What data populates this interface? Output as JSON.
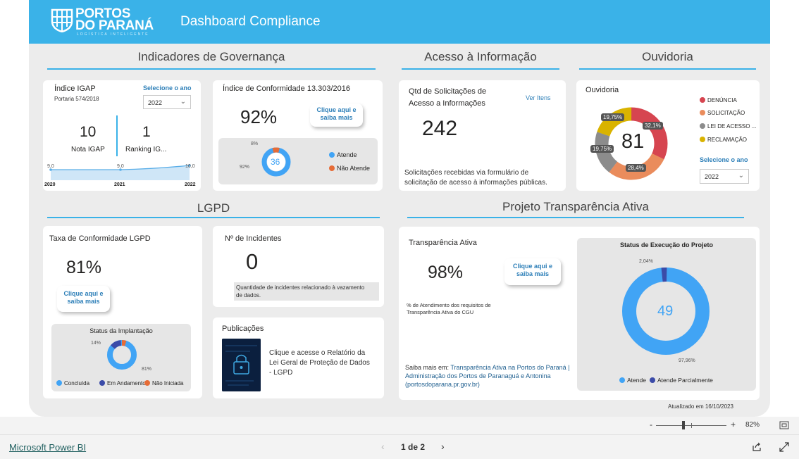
{
  "banner": {
    "logo_line1": "PORTOS",
    "logo_line2": "DO PARANÁ",
    "logo_tagline": "LOGÍSTICA INTELIGENTE",
    "title": "Dashboard Compliance"
  },
  "sections": {
    "governanca": "Indicadores de Governança",
    "acesso": "Acesso à Informação",
    "ouvidoria": "Ouvidoria",
    "lgpd": "LGPD",
    "transparencia": "Projeto Transparência Ativa"
  },
  "igap": {
    "title": "Índice IGAP",
    "subtitle": "Portaria 574/2018",
    "select_label": "Selecione o ano",
    "select_value": "2022",
    "nota_value": "10",
    "nota_label": "Nota IGAP",
    "ranking_value": "1",
    "ranking_label": "Ranking IG...",
    "trend_labels": [
      "9,0",
      "9,0",
      "10,0"
    ],
    "trend_years": [
      "2020",
      "2021",
      "2022"
    ]
  },
  "conformidade": {
    "title": "Índice de Conformidade 13.303/2016",
    "value": "92%",
    "cta": [
      "Clique aqui e",
      "saiba mais"
    ],
    "donut_center": "36",
    "label_small": "8%",
    "label_big": "92%",
    "legend": [
      "Atende",
      "Não Atende"
    ]
  },
  "acesso": {
    "title_line1": "Qtd de Solicitações de",
    "title_line2": "Acesso a Informações",
    "link": "Ver Itens",
    "value": "242",
    "note_line1": "Solicitações recebidas via formulário de",
    "note_line2": "solicitação de acesso à informações públicas."
  },
  "ouvidoria": {
    "title": "Ouvidoria",
    "center": "81",
    "labels": [
      "32,1%",
      "28,4%",
      "19,75%",
      "19,75%"
    ],
    "legend": [
      "DENÚNCIA",
      "SOLICITAÇÃO",
      "LEI DE ACESSO ...",
      "RECLAMAÇÃO"
    ],
    "select_label": "Selecione o ano",
    "select_value": "2022"
  },
  "lgpd": {
    "taxa_title": "Taxa de Conformidade LGPD",
    "taxa_value": "81%",
    "cta": [
      "Clique aqui e",
      "saiba mais"
    ],
    "status_title": "Status da Implantação",
    "status_labels": [
      "14%",
      "81%"
    ],
    "status_legend": [
      "Concluída",
      "Em Andamento",
      "Não Iniciada"
    ],
    "incidentes_title": "Nº de Incidentes",
    "incidentes_value": "0",
    "incidentes_note_line1": "Quantidade de incidentes relacionado à vazamento",
    "incidentes_note_line2": "de dados.",
    "publicacoes_title": "Publicações",
    "publicacoes_text": [
      "Clique e acesse o Relatório da",
      "Lei Geral de Proteção de Dados",
      "- LGPD"
    ]
  },
  "transparencia": {
    "title": "Transparência Ativa",
    "value": "98%",
    "cta": [
      "Clique aqui e",
      "saiba mais"
    ],
    "note_line1": "% de Atendimento dos requisitos de",
    "note_line2": "Transparência Ativa do CGU",
    "saiba_prefix": "Saiba mais em: ",
    "saiba_link_line1": "Transparência Ativa na Portos do Paraná |",
    "saiba_link_line2": "Administração dos Portos de Paranaguá e Antonina",
    "saiba_link_line3": "(portosdoparana.pr.gov.br)",
    "status_title": "Status de Execução do Projeto",
    "donut_center": "49",
    "label_small": "2,04%",
    "label_big": "97,96%",
    "legend": [
      "Atende",
      "Atende Parcialmente"
    ]
  },
  "updated": "Atualizado em 16/10/2023",
  "footer": {
    "zoom": "82%",
    "zoom_minus": "-",
    "zoom_plus": "+"
  },
  "bottom": {
    "brand": "Microsoft Power BI",
    "page": "1 de 2"
  },
  "colors": {
    "accent": "#3ab2e8",
    "blue": "#41a4f5",
    "orange": "#e66c37",
    "navy": "#3b4ba8",
    "red": "#d64550",
    "salmon": "#ea8c5c",
    "grey": "#8c8c8c",
    "yellow": "#d9b300"
  }
}
